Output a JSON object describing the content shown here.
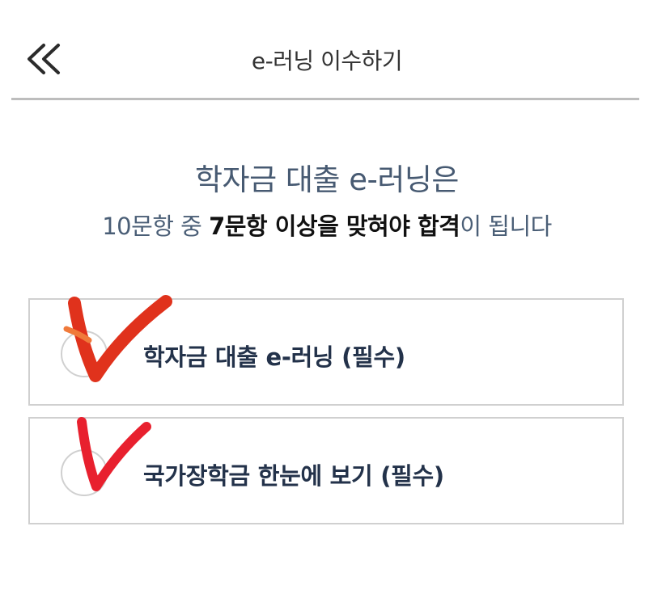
{
  "header": {
    "back_icon": "double-chevron-left-icon",
    "title": "e-러닝 이수하기"
  },
  "intro": {
    "title": "학자금 대출 e-러닝은",
    "sub_part1": "10문항 중 ",
    "sub_part2": "7문항 이상을 맞혀야 합격",
    "sub_part3": "이 됩니다"
  },
  "items": [
    {
      "label": "학자금 대출 e-러닝 (필수)",
      "checked": true
    },
    {
      "label": "국가장학금 한눈에 보기 (필수)",
      "checked": true
    }
  ],
  "colors": {
    "accent_text": "#475a72",
    "label_text": "#23324a",
    "check_mark_1": "#e0321c",
    "check_mark_2": "#e8202e"
  }
}
